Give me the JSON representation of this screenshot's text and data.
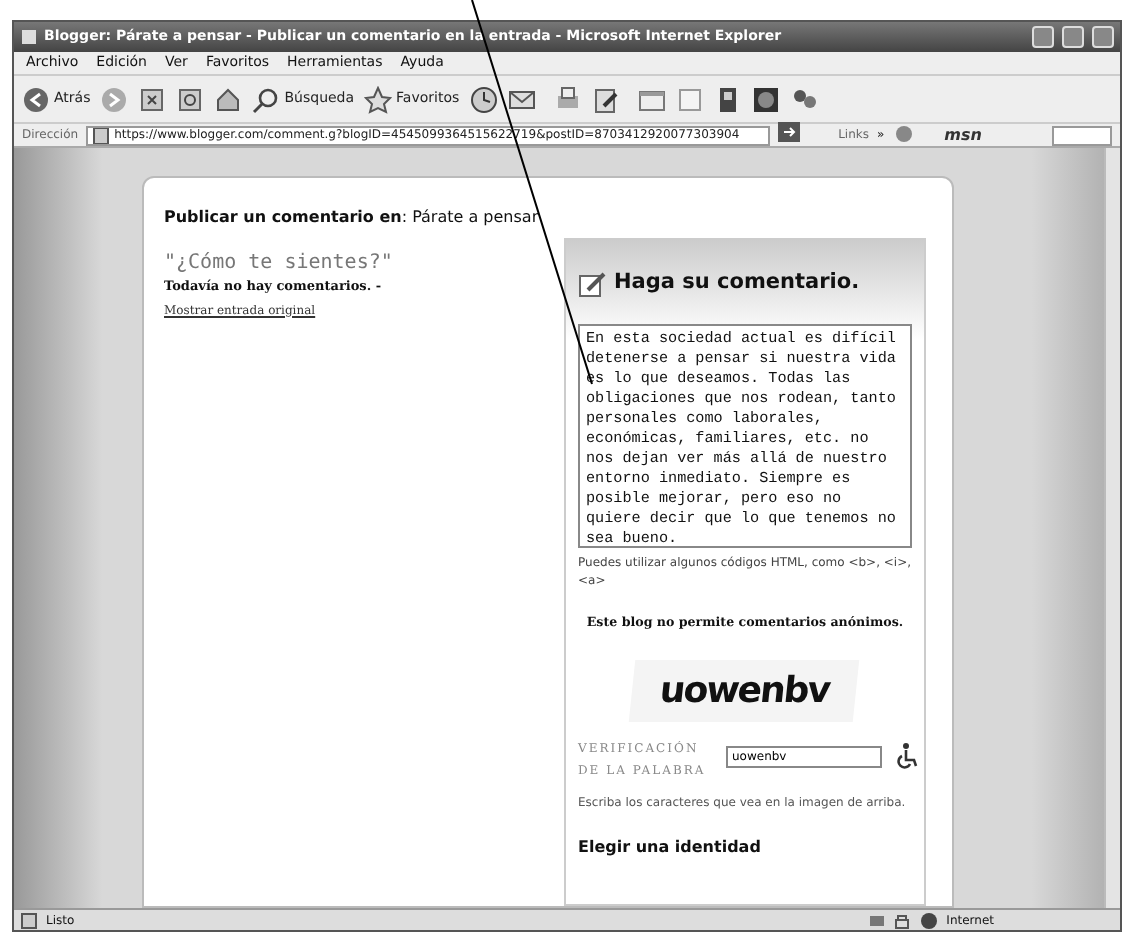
{
  "window": {
    "title": "Blogger: Párate a pensar - Publicar un comentario en la entrada - Microsoft Internet Explorer"
  },
  "menu": [
    "Archivo",
    "Edición",
    "Ver",
    "Favoritos",
    "Herramientas",
    "Ayuda"
  ],
  "toolbar": {
    "back": "Atrás",
    "search": "Búsqueda",
    "favorites": "Favoritos"
  },
  "address": {
    "label": "Dirección",
    "url": "https://www.blogger.com/comment.g?blogID=4545099364515622719&postID=8703412920077303904",
    "links": "Links",
    "links_more": "»",
    "msn": "msn"
  },
  "page": {
    "heading": "**Publicar un comentario en**: Párate a pensar",
    "post_title": "\"¿Cómo te sientes?\"",
    "no_comments": "Todavía no hay comentarios. -",
    "show_post": "Mostrar entrada original"
  },
  "form": {
    "heading": "Haga su comentario.",
    "comment": "En esta sociedad actual es difícil detenerse a pensar si nuestra vida es lo que deseamos. Todas las obligaciones que nos rodean, tanto personales como laborales, económicas, familiares, etc. no nos dejan ver más allá de nuestro entorno inmediato. Siempre es posible mejorar, pero eso no quiere decir que lo que tenemos no sea bueno.",
    "html_hint": "Puedes utilizar algunos códigos HTML, como <b>, <i>, <a>",
    "anonymous": "Este blog no permite comentarios anónimos.",
    "captcha": "uowenbv",
    "verification_label": "VERIFICACIÓN DE LA PALABRA",
    "verification_value": "uowenbv",
    "verification_hint": "Escriba los caracteres que vea en la imagen de arriba.",
    "identity": "Elegir una identidad"
  },
  "status_bar": {
    "text": "Listo",
    "zone": "Internet"
  }
}
